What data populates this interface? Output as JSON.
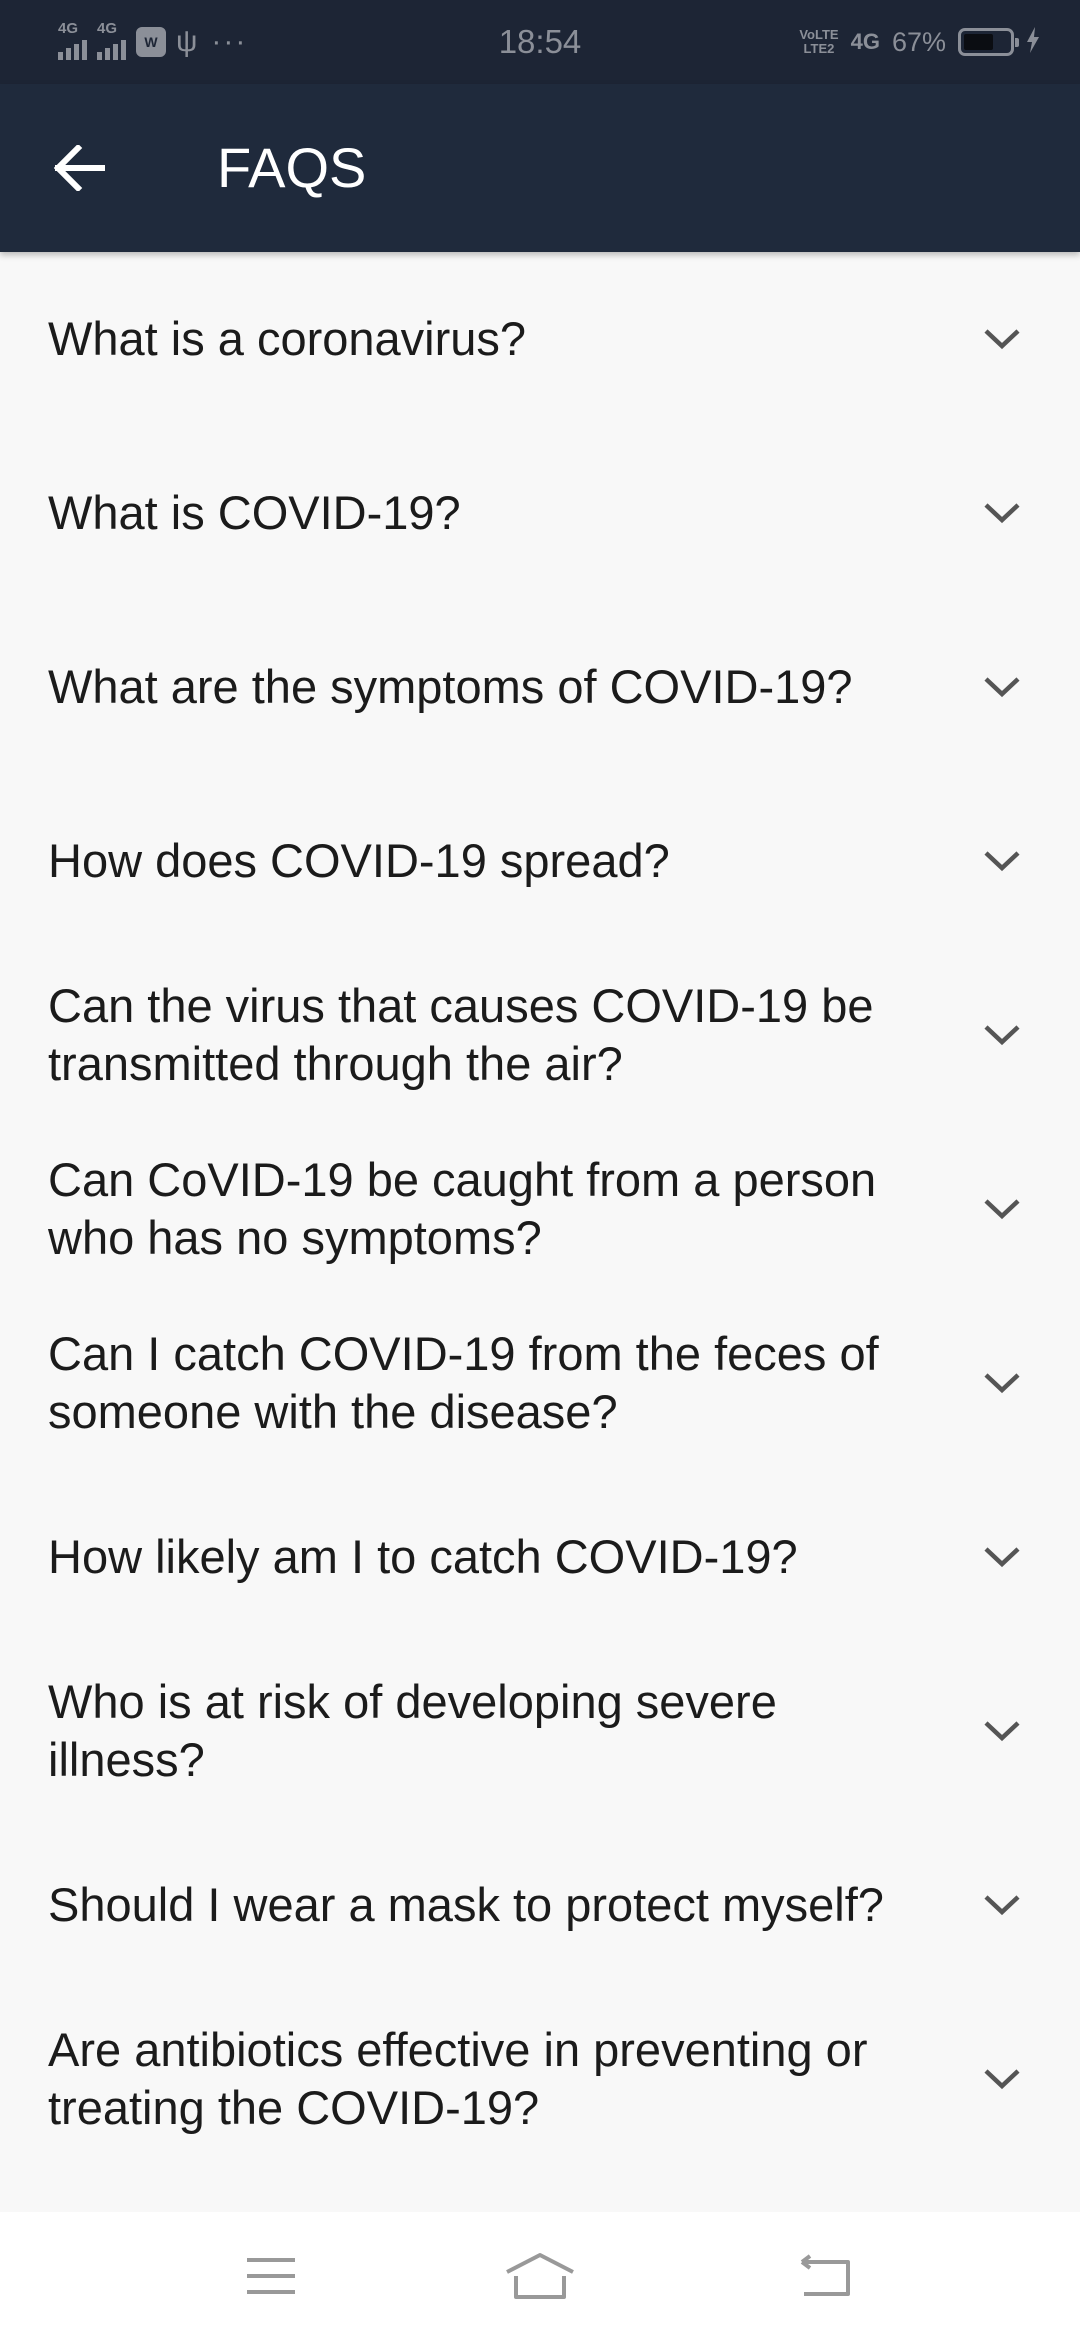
{
  "status_bar": {
    "signal1_label": "4G",
    "signal2_label": "4G",
    "app_badge": "W",
    "usb_symbol": "⚲",
    "more_dots": "···",
    "time": "18:54",
    "volte_line1": "VoLTE",
    "volte_line2": "LTE2",
    "network_type": "4G",
    "battery_percent": "67%",
    "battery_level": 0.67
  },
  "header": {
    "title": "FAQS",
    "background_color": "#1f2a3c"
  },
  "faqs": [
    {
      "question": "What is a coronavirus?"
    },
    {
      "question": "What is COVID-19?"
    },
    {
      "question": "What are the symptoms of COVID-19?"
    },
    {
      "question": "How does COVID-19 spread?"
    },
    {
      "question": "Can the virus that causes COVID-19 be transmitted through the air?"
    },
    {
      "question": "Can CoVID-19 be caught from a person who has no symptoms?"
    },
    {
      "question": "Can I catch COVID-19 from the feces of someone with the disease?"
    },
    {
      "question": "How likely am I to catch COVID-19?"
    },
    {
      "question": "Who is at risk of developing severe illness?"
    },
    {
      "question": "Should I wear a mask to protect myself?"
    },
    {
      "question": "Are antibiotics effective in preventing or treating the COVID-19?"
    }
  ],
  "icons": {
    "back": "arrow-back-icon",
    "expand": "chevron-down-icon",
    "nav_menu": "menu-icon",
    "nav_home": "home-icon",
    "nav_back": "back-icon"
  }
}
